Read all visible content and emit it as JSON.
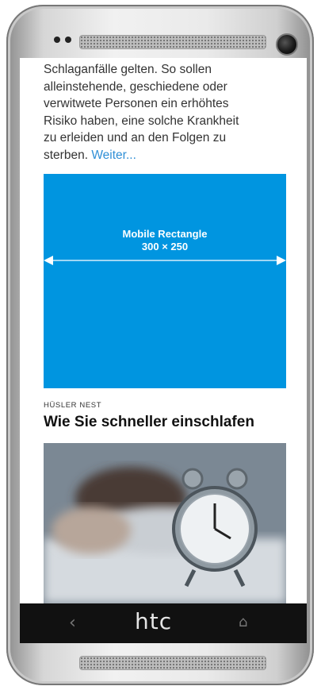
{
  "device": {
    "brand": "htc",
    "icons": [
      "front-camera-icon",
      "back-icon",
      "home-icon"
    ]
  },
  "article": {
    "lines": [
      "Schlaganfälle gelten. So sollen",
      "alleinstehende, geschiedene oder",
      "verwitwete Personen ein erhöhtes",
      "Risiko haben, eine solche Krankheit",
      "zu erleiden und an den Folgen zu"
    ],
    "last_line": "sterben.",
    "read_more": "Weiter..."
  },
  "ad": {
    "title": "Mobile Rectangle",
    "size": "300 × 250",
    "color": "#0095e0"
  },
  "teaser": {
    "kicker": "HÜSLER NEST",
    "headline": "Wie Sie schneller einschlafen"
  },
  "colors": {
    "link": "#2f8fd6",
    "navbar": "#111111"
  }
}
